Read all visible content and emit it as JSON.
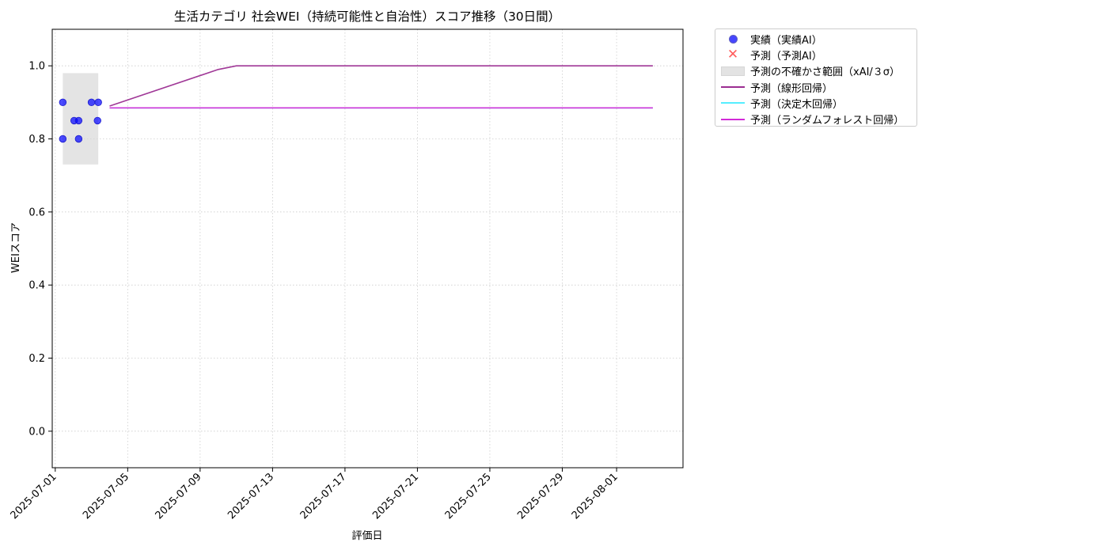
{
  "chart_data": {
    "type": "line",
    "title": "生活カテゴリ 社会WEI（持続可能性と自治性）スコア推移（30日間）",
    "xlabel": "評価日",
    "ylabel": "WEIスコア",
    "xlim": [
      "2025-06-30 20:00",
      "2025-08-04 16:00"
    ],
    "ylim": [
      -0.1,
      1.1
    ],
    "x_ticks": [
      "2025-07-01",
      "2025-07-05",
      "2025-07-09",
      "2025-07-13",
      "2025-07-17",
      "2025-07-21",
      "2025-07-25",
      "2025-07-29",
      "2025-08-01"
    ],
    "y_ticks": [
      "0.0",
      "0.2",
      "0.4",
      "0.6",
      "0.8",
      "1.0"
    ],
    "grid": true,
    "legend_position": "outside-top-right",
    "actual": {
      "name": "実績（実績AI）",
      "points": [
        {
          "x": "2025-07-01 10:00",
          "y": 0.9
        },
        {
          "x": "2025-07-01 10:00",
          "y": 0.8
        },
        {
          "x": "2025-07-02 01:00",
          "y": 0.85
        },
        {
          "x": "2025-07-02 07:00",
          "y": 0.85
        },
        {
          "x": "2025-07-02 07:00",
          "y": 0.8
        },
        {
          "x": "2025-07-03 00:00",
          "y": 0.9
        },
        {
          "x": "2025-07-03 09:00",
          "y": 0.9
        },
        {
          "x": "2025-07-03 08:00",
          "y": 0.85
        }
      ]
    },
    "uncertainty_band": {
      "name": "予測の不確かさ範囲（xAI/３σ）",
      "x_start": "2025-07-01 10:00",
      "x_end": "2025-07-03 09:00",
      "y_low": 0.73,
      "y_high": 0.98
    },
    "series": [
      {
        "name": "予測（予測AI）",
        "style": "marker-x",
        "color": "#ff3b3b",
        "points": []
      },
      {
        "name": "予測（線形回帰）",
        "color": "#9b2d91",
        "points": [
          {
            "x": "2025-07-04",
            "y": 0.89
          },
          {
            "x": "2025-07-10",
            "y": 0.99
          },
          {
            "x": "2025-07-11",
            "y": 1.0
          },
          {
            "x": "2025-08-03",
            "y": 1.0
          }
        ]
      },
      {
        "name": "予測（決定木回帰）",
        "color": "#55eeff",
        "points": [
          {
            "x": "2025-07-04",
            "y": 0.885
          },
          {
            "x": "2025-08-03",
            "y": 0.885
          }
        ]
      },
      {
        "name": "予測（ランダムフォレスト回帰）",
        "color": "#d22ad8",
        "points": [
          {
            "x": "2025-07-04",
            "y": 0.885
          },
          {
            "x": "2025-08-03",
            "y": 0.885
          }
        ]
      }
    ]
  }
}
